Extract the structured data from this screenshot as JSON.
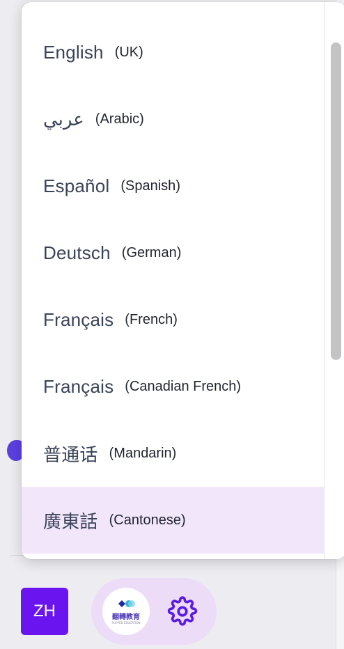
{
  "languages": [
    {
      "native": "English",
      "english": "UK",
      "selected": false
    },
    {
      "native": "عربي",
      "english": "Arabic",
      "selected": false
    },
    {
      "native": "Español",
      "english": "Spanish",
      "selected": false
    },
    {
      "native": "Deutsch",
      "english": "German",
      "selected": false
    },
    {
      "native": "Français",
      "english": "French",
      "selected": false
    },
    {
      "native": "Français",
      "english": "Canadian French",
      "selected": false
    },
    {
      "native": "普通话",
      "english": "Mandarin",
      "selected": false
    },
    {
      "native": "廣東話",
      "english": "Cantonese",
      "selected": true
    }
  ],
  "footer": {
    "language_button": "ZH",
    "logo_text": "翻轉教育",
    "logo_subtext": "FLIPPED EDUCATION",
    "logo_icon": "flipped-education-logo",
    "settings_icon": "gear-icon"
  },
  "colors": {
    "accent": "#6a14f0",
    "selected_bg": "#f2e6fb",
    "pill_bg": "#ecdcf8"
  }
}
